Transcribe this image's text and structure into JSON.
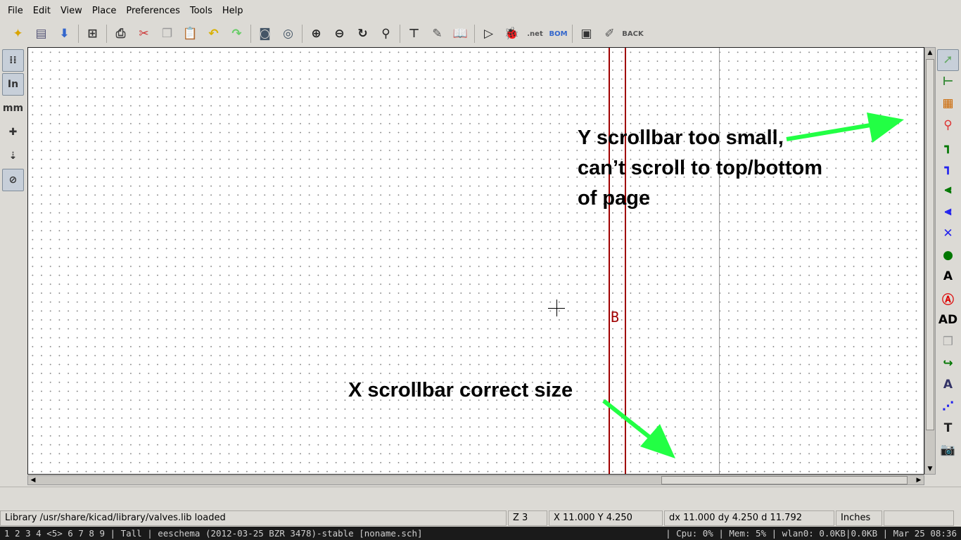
{
  "menu": [
    "File",
    "Edit",
    "View",
    "Place",
    "Preferences",
    "Tools",
    "Help"
  ],
  "toolbar": [
    {
      "name": "new-schematic-icon",
      "glyph": "✦",
      "color": "#d9a400"
    },
    {
      "name": "open-icon",
      "glyph": "▤",
      "color": "#557"
    },
    {
      "name": "save-icon",
      "glyph": "⬇",
      "color": "#36c"
    },
    {
      "sep": true
    },
    {
      "name": "page-settings-icon",
      "glyph": "⊞",
      "color": "#333"
    },
    {
      "sep": true
    },
    {
      "name": "print-icon",
      "glyph": "⎙",
      "color": "#444"
    },
    {
      "name": "cut-icon",
      "glyph": "✂",
      "color": "#c33"
    },
    {
      "name": "copy-icon",
      "glyph": "❐",
      "color": "#999"
    },
    {
      "name": "paste-icon",
      "glyph": "📋",
      "color": "#999"
    },
    {
      "name": "undo-icon",
      "glyph": "↶",
      "color": "#d9b000"
    },
    {
      "name": "redo-icon",
      "glyph": "↷",
      "color": "#6c6"
    },
    {
      "sep": true
    },
    {
      "name": "find-icon",
      "glyph": "◙",
      "color": "#456"
    },
    {
      "name": "find-replace-icon",
      "glyph": "◎",
      "color": "#456"
    },
    {
      "sep": true
    },
    {
      "name": "zoom-in-icon",
      "glyph": "⊕",
      "color": "#222"
    },
    {
      "name": "zoom-out-icon",
      "glyph": "⊖",
      "color": "#222"
    },
    {
      "name": "redraw-icon",
      "glyph": "↻",
      "color": "#222"
    },
    {
      "name": "zoom-fit-icon",
      "glyph": "⚲",
      "color": "#222"
    },
    {
      "sep": true
    },
    {
      "name": "hierarchy-icon",
      "glyph": "⊤",
      "color": "#333"
    },
    {
      "name": "library-editor-icon",
      "glyph": "✎",
      "color": "#555"
    },
    {
      "name": "library-browser-icon",
      "glyph": "📖",
      "color": "#555"
    },
    {
      "sep": true
    },
    {
      "name": "annotate-icon",
      "glyph": "▷",
      "color": "#222"
    },
    {
      "name": "erc-icon",
      "glyph": "🐞",
      "color": "#c00"
    },
    {
      "name": "netlist-icon",
      "glyph": ".net",
      "color": "#555"
    },
    {
      "name": "bom-icon",
      "glyph": "BOM",
      "color": "#36c"
    },
    {
      "sep": true
    },
    {
      "name": "cvpcb-icon",
      "glyph": "▣",
      "color": "#333"
    },
    {
      "name": "pcbnew-icon",
      "glyph": "✐",
      "color": "#555"
    },
    {
      "name": "back-annotate-icon",
      "glyph": "BACK",
      "color": "#555"
    }
  ],
  "left_toolbar": [
    {
      "name": "grid-toggle-icon",
      "glyph": "⁞⁞",
      "pressed": true
    },
    {
      "name": "units-inches-icon",
      "glyph": "In",
      "pressed": true
    },
    {
      "name": "units-mm-icon",
      "glyph": "mm",
      "pressed": false
    },
    {
      "name": "cursor-shape-icon",
      "glyph": "✚",
      "pressed": false
    },
    {
      "name": "hidden-pins-icon",
      "glyph": "⇣",
      "pressed": false
    },
    {
      "name": "bus-wire-45-icon",
      "glyph": "⊘",
      "pressed": true
    }
  ],
  "right_toolbar": [
    {
      "name": "select-arrow-icon",
      "glyph": "➚",
      "color": "#6a6",
      "pressed": true
    },
    {
      "name": "hierarchy-navigator-icon",
      "glyph": "⊢",
      "color": "#383"
    },
    {
      "name": "add-component-icon",
      "glyph": "▦",
      "color": "#c60"
    },
    {
      "name": "add-power-icon",
      "glyph": "⚲",
      "color": "#d33"
    },
    {
      "name": "add-wire-icon",
      "glyph": "┓",
      "color": "#070"
    },
    {
      "name": "add-bus-icon",
      "glyph": "┓",
      "color": "#22e"
    },
    {
      "name": "wire-bus-entry-icon",
      "glyph": "⫷",
      "color": "#070"
    },
    {
      "name": "bus-bus-entry-icon",
      "glyph": "⫷",
      "color": "#22e"
    },
    {
      "name": "no-connect-icon",
      "glyph": "✕",
      "color": "#22e"
    },
    {
      "name": "add-junction-icon",
      "glyph": "●",
      "color": "#070"
    },
    {
      "name": "add-net-label-icon",
      "glyph": "A",
      "color": "#000"
    },
    {
      "name": "add-global-label-icon",
      "glyph": "Ⓐ",
      "color": "#d00"
    },
    {
      "name": "add-hier-label-icon",
      "glyph": "AD",
      "color": "#000"
    },
    {
      "name": "add-hier-sheet-icon",
      "glyph": "❒",
      "color": "#999"
    },
    {
      "name": "import-sheet-pin-icon",
      "glyph": "↪",
      "color": "#070"
    },
    {
      "name": "add-sheet-pin-icon",
      "glyph": "A",
      "color": "#336"
    },
    {
      "name": "add-graphic-line-icon",
      "glyph": "⋰",
      "color": "#22e"
    },
    {
      "name": "add-text-icon",
      "glyph": "T",
      "color": "#222"
    },
    {
      "name": "add-image-icon",
      "glyph": "📷",
      "color": "#888"
    }
  ],
  "canvas": {
    "sheet_label": "B",
    "colors": {
      "border": "#a00000",
      "grid": "#8a8a8a"
    }
  },
  "annotations": {
    "y_scrollbar": [
      "Y scrollbar too small,",
      "can’t scroll to top/bottom",
      "of page"
    ],
    "x_scrollbar": "X scrollbar correct size",
    "arrow_color": "#22ff44"
  },
  "scrollbars": {
    "vertical_visible_fraction": 0.9,
    "horizontal_position": 0.71,
    "horizontal_visible_fraction": 0.28
  },
  "status": {
    "message": "Library /usr/share/kicad/library/valves.lib loaded",
    "zoom": "Z 3",
    "abs_coords": "X 11.000  Y 4.250",
    "rel_coords": "dx 11.000  dy 4.250  d 11.792",
    "units": "Inches"
  },
  "wm": {
    "left": "1 2 3 4 <5> 6 7 8 9 | Tall | eeschema (2012-03-25 BZR 3478)-stable [noname.sch]",
    "right": "| Cpu: 0% | Mem: 5% | wlan0: 0.0KB|0.0KB | Mar 25 08:36"
  }
}
